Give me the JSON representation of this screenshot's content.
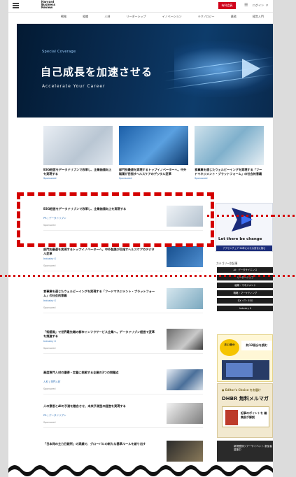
{
  "header": {
    "logo_lines": [
      "Harvard",
      "Business",
      "Review"
    ],
    "cta_label": "有料会員",
    "login_label": "ログイン",
    "nav": [
      "戦略",
      "組織",
      "人材",
      "リーダーシップ",
      "イノベーション",
      "テクノロジー",
      "業務",
      "経営入門"
    ]
  },
  "hero": {
    "kicker": "Special Coverage",
    "title": "自己成長を加速させる",
    "subtitle": "Accelerate Your Career"
  },
  "cards": [
    {
      "title": "ESG経営をデータドリブンで改革し、企業価値向上を実現する",
      "meta": "Sponsored"
    },
    {
      "title": "部門別最適を実現するトップイノベーターへ。中外製薬が目指すヘルスケアのデジタル変革",
      "meta": "Sponsored"
    },
    {
      "title": "食事業を通じたウェルビーイングを実現する「フードマネジメント・プラットフォーム」の社会的意義",
      "meta": "Sponsored"
    }
  ],
  "list": [
    {
      "title": "ESG経営をデータドリブンで改革し、企業価値向上を実現する",
      "tag": "PR | データドリブン",
      "meta": "Sponsored"
    },
    {
      "title": "部門別最適を実現するトップイノベーターへ。中外製薬が目指すヘルスケアのデジタル変革",
      "tag": "Industry X",
      "meta": "Sponsored"
    },
    {
      "title": "食事業を通じたウェルビーイングを実現する「フードマネジメント・プラットフォーム」の社会的意義",
      "tag": "Industry X",
      "meta": "Sponsored"
    },
    {
      "title": "「街語風」で世界最先端の都市インフラサービス企業へ。データドリブン経営で変革を推進する",
      "tag": "Industry X",
      "meta": "Sponsored"
    },
    {
      "title": "高度専門人材の獲得・定着に挑戦する企業の3つの問題点",
      "tag": "人材 | 専門人材",
      "meta": "Sponsored"
    },
    {
      "title": "人の意思とAIの予測を融合させ、未来予測型の経営を実現する",
      "tag": "PR | データドリブン",
      "meta": "Sponsored"
    },
    {
      "title": "「日本発の主力日銀所」の実績で、グローバルの新たな基準ルールを創り出す",
      "tag": "",
      "meta": ""
    }
  ],
  "sidebar": {
    "ad1_caption": "Let there be change",
    "ad1_sub": "アクセンチュア 50年にわたる変化に挑む",
    "category_title": "カテゴリー別記事",
    "categories": [
      "AI・データサイエンス",
      "リーダーシップ",
      "組織・マネジメント",
      "戦略・マーケティング",
      "DX・IT・ESG",
      "Industry X"
    ],
    "ad2_badge": "月12冊分",
    "ad2_head": "約12冊分を読む",
    "ad3_line1": "● Editor's Choice をお届け",
    "ad3_line2": "DHBR 無料メルマガ",
    "ad3_box": "記事のポイントを 編集部が解説",
    "ad4_text": "新規登録ツアーやイベント 参加者募集中"
  },
  "colors": {
    "accent": "#d0021b",
    "hero_bg": "#0a2e55",
    "link": "#2a6db5",
    "annotation": "#d40000"
  }
}
